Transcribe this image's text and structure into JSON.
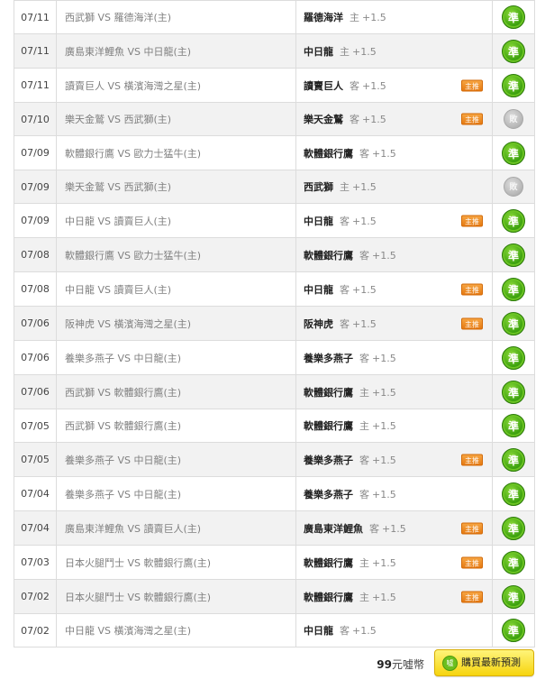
{
  "rows": [
    {
      "date": "07/11",
      "match": "西武獅 VS 羅德海洋(主)",
      "pick_team": "羅德海洋",
      "pick_side": "主",
      "pick_line": "+1.5",
      "badge": "",
      "action": "準",
      "active": true
    },
    {
      "date": "07/11",
      "match": "廣島東洋鯉魚 VS 中日龍(主)",
      "pick_team": "中日龍",
      "pick_side": "主",
      "pick_line": "+1.5",
      "badge": "",
      "action": "準",
      "active": true
    },
    {
      "date": "07/11",
      "match": "讀賣巨人 VS 橫濱海灣之星(主)",
      "pick_team": "讀賣巨人",
      "pick_side": "客",
      "pick_line": "+1.5",
      "badge": "主推",
      "action": "準",
      "active": true
    },
    {
      "date": "07/10",
      "match": "樂天金鷲 VS 西武獅(主)",
      "pick_team": "樂天金鷲",
      "pick_side": "客",
      "pick_line": "+1.5",
      "badge": "主推",
      "action": "敗",
      "active": false
    },
    {
      "date": "07/09",
      "match": "軟體銀行鷹 VS 歐力士猛牛(主)",
      "pick_team": "軟體銀行鷹",
      "pick_side": "客",
      "pick_line": "+1.5",
      "badge": "",
      "action": "準",
      "active": true
    },
    {
      "date": "07/09",
      "match": "樂天金鷲 VS 西武獅(主)",
      "pick_team": "西武獅",
      "pick_side": "主",
      "pick_line": "+1.5",
      "badge": "",
      "action": "敗",
      "active": false
    },
    {
      "date": "07/09",
      "match": "中日龍 VS 讀賣巨人(主)",
      "pick_team": "中日龍",
      "pick_side": "客",
      "pick_line": "+1.5",
      "badge": "主推",
      "action": "準",
      "active": true
    },
    {
      "date": "07/08",
      "match": "軟體銀行鷹 VS 歐力士猛牛(主)",
      "pick_team": "軟體銀行鷹",
      "pick_side": "客",
      "pick_line": "+1.5",
      "badge": "",
      "action": "準",
      "active": true
    },
    {
      "date": "07/08",
      "match": "中日龍 VS 讀賣巨人(主)",
      "pick_team": "中日龍",
      "pick_side": "客",
      "pick_line": "+1.5",
      "badge": "主推",
      "action": "準",
      "active": true
    },
    {
      "date": "07/06",
      "match": "阪神虎 VS 橫濱海灣之星(主)",
      "pick_team": "阪神虎",
      "pick_side": "客",
      "pick_line": "+1.5",
      "badge": "主推",
      "action": "準",
      "active": true
    },
    {
      "date": "07/06",
      "match": "養樂多燕子 VS 中日龍(主)",
      "pick_team": "養樂多燕子",
      "pick_side": "客",
      "pick_line": "+1.5",
      "badge": "",
      "action": "準",
      "active": true
    },
    {
      "date": "07/06",
      "match": "西武獅 VS 軟體銀行鷹(主)",
      "pick_team": "軟體銀行鷹",
      "pick_side": "主",
      "pick_line": "+1.5",
      "badge": "",
      "action": "準",
      "active": true
    },
    {
      "date": "07/05",
      "match": "西武獅 VS 軟體銀行鷹(主)",
      "pick_team": "軟體銀行鷹",
      "pick_side": "主",
      "pick_line": "+1.5",
      "badge": "",
      "action": "準",
      "active": true
    },
    {
      "date": "07/05",
      "match": "養樂多燕子 VS 中日龍(主)",
      "pick_team": "養樂多燕子",
      "pick_side": "客",
      "pick_line": "+1.5",
      "badge": "主推",
      "action": "準",
      "active": true
    },
    {
      "date": "07/04",
      "match": "養樂多燕子 VS 中日龍(主)",
      "pick_team": "養樂多燕子",
      "pick_side": "客",
      "pick_line": "+1.5",
      "badge": "",
      "action": "準",
      "active": true
    },
    {
      "date": "07/04",
      "match": "廣島東洋鯉魚 VS 讀賣巨人(主)",
      "pick_team": "廣島東洋鯉魚",
      "pick_side": "客",
      "pick_line": "+1.5",
      "badge": "主推",
      "action": "準",
      "active": true
    },
    {
      "date": "07/03",
      "match": "日本火腿鬥士 VS 軟體銀行鷹(主)",
      "pick_team": "軟體銀行鷹",
      "pick_side": "主",
      "pick_line": "+1.5",
      "badge": "主推",
      "action": "準",
      "active": true
    },
    {
      "date": "07/02",
      "match": "日本火腿鬥士 VS 軟體銀行鷹(主)",
      "pick_team": "軟體銀行鷹",
      "pick_side": "主",
      "pick_line": "+1.5",
      "badge": "主推",
      "action": "準",
      "active": true
    },
    {
      "date": "07/02",
      "match": "中日龍 VS 橫濱海灣之星(主)",
      "pick_team": "中日龍",
      "pick_side": "客",
      "pick_line": "+1.5",
      "badge": "",
      "action": "準",
      "active": true
    }
  ],
  "footer": {
    "price_amount": "99",
    "price_unit": "元噓幣",
    "buy_label": "購買最新預測",
    "buy_icon": "噓"
  },
  "colors": {
    "active_button": "#3ea310",
    "inactive_button": "#b9b9b9",
    "badge": "#e67a12",
    "buy_button": "#f6d40e"
  }
}
